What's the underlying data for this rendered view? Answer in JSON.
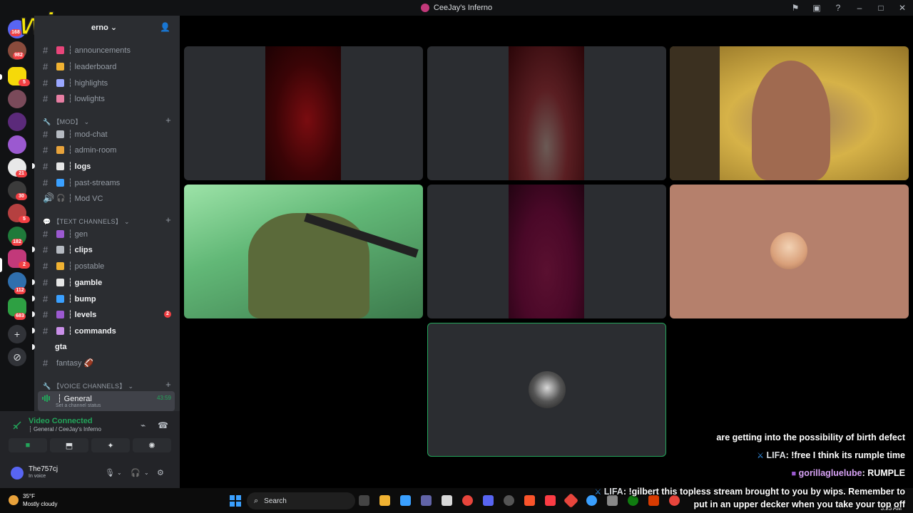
{
  "window": {
    "title": "CeeJay's Inferno"
  },
  "server": {
    "name_partial": "erno",
    "chevron": "⌄"
  },
  "rail_badges": {
    "dm": "168",
    "s1": "982",
    "s2": "5",
    "s3": "21",
    "s4": "30",
    "s5": "5",
    "s6": "182",
    "s7": "2",
    "s8": "112",
    "s9": "683"
  },
  "channels": [
    {
      "label": "┆ announcements",
      "emoji_color": "#e8457a",
      "unread": false
    },
    {
      "label": "┆ leaderboard",
      "emoji_color": "#f0b232",
      "unread": false
    },
    {
      "label": "┆ highlights",
      "emoji_color": "#9aa7ff",
      "unread": false
    },
    {
      "label": "┆ lowlights",
      "emoji_color": "#e77ea3",
      "unread": false
    }
  ],
  "categories": {
    "mod": "【MOD】",
    "text": "【TEXT CHANNELS】",
    "voice": "【VOICE CHANNELS】"
  },
  "mod_channels": [
    {
      "label": "┆ mod-chat"
    },
    {
      "label": "┆ admin-room"
    },
    {
      "label": "┆ logs"
    },
    {
      "label": "┆ past-streams"
    },
    {
      "label": "┆ Mod VC"
    }
  ],
  "text_channels": [
    {
      "label": "┆ gen"
    },
    {
      "label": "┆ clips"
    },
    {
      "label": "┆ postable"
    },
    {
      "label": "┆ gamble"
    },
    {
      "label": "┆ bump"
    },
    {
      "label": "┆ levels",
      "mention": "2"
    },
    {
      "label": "┆ commands"
    },
    {
      "label": "gta"
    },
    {
      "label": "fantasy 🏈"
    }
  ],
  "voice_channel": {
    "name": "┆ General",
    "time": "43:59",
    "status": "Set a channel status"
  },
  "connection": {
    "state": "Video Connected",
    "location": "┆ General / CeeJay's Inferno"
  },
  "user": {
    "name": "The757cj",
    "status": "In voice"
  },
  "chat_overlay": [
    {
      "user": "",
      "text": "are getting into the possibility of birth defect"
    },
    {
      "user": "LIFA",
      "text": ": !free I think its rumple time"
    },
    {
      "user": "gorillagluelube",
      "text": ": RUMPLE"
    },
    {
      "user": "LIFA",
      "text": ": !gilbert this topless stream brought to you by wips. Remember to"
    },
    {
      "user": "",
      "text": "put in an upper decker when you take your top off"
    }
  ],
  "taskbar": {
    "temp": "35°F",
    "weather": "Mostly cloudy",
    "search": "Search",
    "time": "3:23 AM"
  },
  "colors": {
    "accent_green": "#23a55a",
    "mention_red": "#f23f43",
    "sidebar_bg": "#2b2d31"
  }
}
